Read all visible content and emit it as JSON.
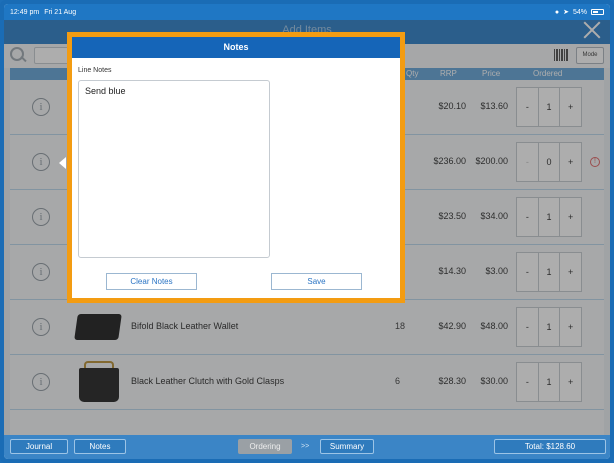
{
  "status_bar": {
    "time": "12:49 pm",
    "date": "Fri 21 Aug",
    "battery": "54%"
  },
  "header": {
    "title": "Add Items"
  },
  "search": {
    "mode_label": "Mode"
  },
  "columns": {
    "qty": "Qty",
    "rrp": "RRP",
    "price": "Price",
    "ordered": "Ordered"
  },
  "rows": [
    {
      "name": "",
      "qty": "",
      "rrp": "$20.10",
      "price": "$13.60",
      "ordered": "1"
    },
    {
      "name": "",
      "qty": "",
      "rrp": "$236.00",
      "price": "$200.00",
      "ordered": "0"
    },
    {
      "name": "",
      "qty": "",
      "rrp": "$23.50",
      "price": "$34.00",
      "ordered": "1"
    },
    {
      "name": "",
      "qty": "",
      "rrp": "$14.30",
      "price": "$3.00",
      "ordered": "1"
    },
    {
      "name": "Bifold Black Leather Wallet",
      "qty": "18",
      "rrp": "$42.90",
      "price": "$48.00",
      "ordered": "1"
    },
    {
      "name": "Black Leather Clutch with Gold Clasps",
      "qty": "6",
      "rrp": "$28.30",
      "price": "$30.00",
      "ordered": "1"
    }
  ],
  "stepper": {
    "minus": "-",
    "plus": "+"
  },
  "info_glyph": "i",
  "warn_glyph": "!",
  "bottom_bar": {
    "journal": "Journal",
    "notes": "Notes",
    "ordering": "Ordering",
    "chevrons": ">>",
    "summary": "Summary",
    "total": "Total: $128.60"
  },
  "modal": {
    "title": "Notes",
    "label": "Line Notes",
    "notes_value": "Send blue",
    "clear_label": "Clear Notes",
    "save_label": "Save"
  },
  "colors": {
    "brand": "#1f77c4",
    "modal_border": "#f39c12",
    "modal_header": "#1565b8",
    "link": "#2a74c4"
  }
}
